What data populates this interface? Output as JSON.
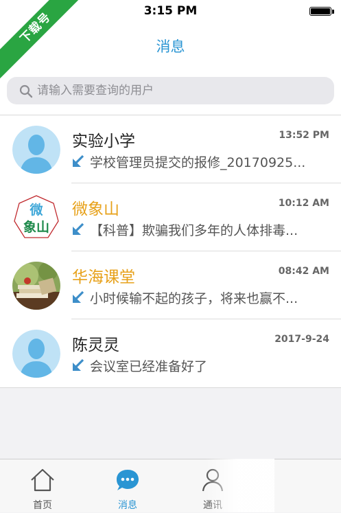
{
  "status_bar": {
    "time": "3:15 PM"
  },
  "corner_ribbon": {
    "text": "下载号",
    "color": "#2aa542"
  },
  "header": {
    "title": "消息"
  },
  "search": {
    "placeholder": "请输入需要查询的用户"
  },
  "conversations": [
    {
      "name": "实验小学",
      "time": "13:52 PM",
      "message": "学校管理员提交的报修_20170925...",
      "avatar": "default-person",
      "name_color": "#222222"
    },
    {
      "name": "微象山",
      "time": "10:12 AM",
      "message": "【科普】欺骗我们多年的人体排毒...",
      "avatar": "logo",
      "avatar_text": [
        "微",
        "象山"
      ],
      "name_color": "#e7a11a"
    },
    {
      "name": "华海课堂",
      "time": "08:42 AM",
      "message": "小时候输不起的孩子，将来也赢不...",
      "avatar": "books-photo",
      "name_color": "#e7a11a"
    },
    {
      "name": "陈灵灵",
      "time": "2017-9-24",
      "message": "会议室已经准备好了",
      "avatar": "default-person",
      "name_color": "#222222"
    }
  ],
  "tabs": [
    {
      "label": "首页",
      "icon": "home-icon",
      "active": false
    },
    {
      "label": "消息",
      "icon": "chat-bubble-icon",
      "active": true
    },
    {
      "label": "通讯",
      "icon": "contacts-icon",
      "active": false
    }
  ],
  "colors": {
    "accent": "#2a95d3",
    "highlight_name": "#e7a11a"
  }
}
